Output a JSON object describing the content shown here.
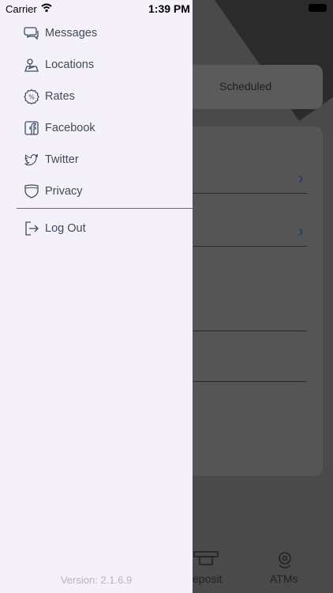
{
  "status_bar": {
    "carrier": "Carrier",
    "time": "1:39 PM"
  },
  "drawer": {
    "items": [
      {
        "label": "Messages",
        "icon": "messages-icon"
      },
      {
        "label": "Locations",
        "icon": "locations-icon"
      },
      {
        "label": "Rates",
        "icon": "rates-icon"
      },
      {
        "label": "Facebook",
        "icon": "facebook-icon"
      },
      {
        "label": "Twitter",
        "icon": "twitter-icon"
      },
      {
        "label": "Privacy",
        "icon": "privacy-icon"
      }
    ],
    "logout_label": "Log Out",
    "version": "Version: 2.1.6.9"
  },
  "background": {
    "tab_label": "Scheduled",
    "bottom_nav": {
      "deposit_label": "eposit",
      "atms_label": "ATMs"
    }
  },
  "colors": {
    "drawer_bg": "#f4f1fb",
    "menu_text": "#3f4b5b",
    "accent": "#29425f"
  }
}
